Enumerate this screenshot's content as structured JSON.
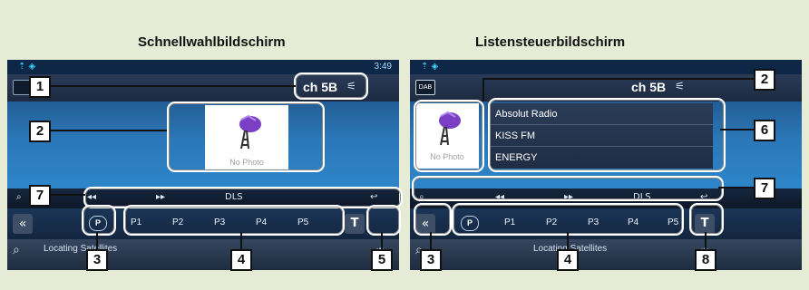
{
  "left": {
    "title": "Schnellwahlbildschirm",
    "time": "3:49",
    "channel": "ch 5B",
    "no_photo": "No Photo",
    "controls": {
      "prev": "◂◂",
      "next": "▸▸",
      "dls": "DLS"
    },
    "preset_p": "P",
    "presets": [
      "P1",
      "P2",
      "P3",
      "P4",
      "P5"
    ],
    "back": "«",
    "t_button": "T",
    "status": "Locating Satellites"
  },
  "right": {
    "title": "Listensteuerbildschirm",
    "channel": "ch 5B",
    "source_icon": "DAB",
    "no_photo": "No Photo",
    "list": [
      "Absolut Radio",
      "KISS FM",
      "ENERGY"
    ],
    "controls": {
      "prev": "◂◂",
      "next": "▸▸",
      "dls": "DLS"
    },
    "preset_p": "P",
    "presets": [
      "P1",
      "P2",
      "P3",
      "P4",
      "P5"
    ],
    "back": "«",
    "t_button": "T",
    "status": "Locating Satellites"
  },
  "callouts": {
    "c1": "1",
    "c2": "2",
    "c3": "3",
    "c4": "4",
    "c5": "5",
    "c6": "6",
    "c7": "7",
    "c8": "8"
  },
  "icons": {
    "search": "search-icon",
    "repeat": "repeat-icon",
    "settings": "gear-icon",
    "signal": "antenna-icon"
  }
}
